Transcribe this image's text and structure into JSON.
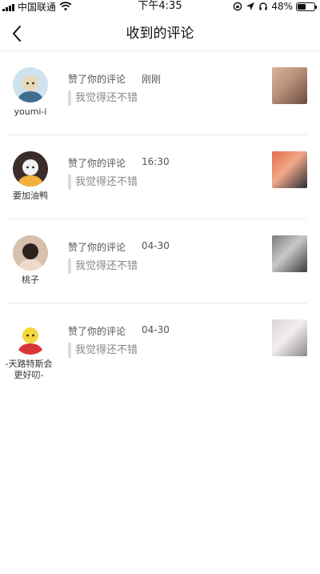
{
  "status_bar": {
    "carrier": "中国联通",
    "time": "下午4:35",
    "battery": "48%",
    "battery_level": 0.48
  },
  "nav": {
    "title": "收到的评论",
    "back_icon": "chevron-left-icon"
  },
  "notifications": [
    {
      "user": "youmi-i",
      "action": "赞了你的评论",
      "time": "刚刚",
      "comment": "我觉得还不错",
      "avatar_colors": [
        "#cfe3ee",
        "#e9d9b8",
        "#3f6e91"
      ],
      "thumb_colors": [
        "#d8b49b",
        "#6a4b3f",
        "#b98f7a"
      ]
    },
    {
      "user": "要加油鸭",
      "action": "赞了你的评论",
      "time": "16:30",
      "comment": "我觉得还不错",
      "avatar_colors": [
        "#3a2d2a",
        "#f2f2f2",
        "#f0b23a"
      ],
      "thumb_colors": [
        "#e36f4d",
        "#2d2e36",
        "#f0a88a"
      ]
    },
    {
      "user": "桃子",
      "action": "赞了你的评论",
      "time": "04-30",
      "comment": "我觉得还不错",
      "avatar_colors": [
        "#d8c0ae",
        "#2b211d",
        "#f0d9c8"
      ],
      "thumb_colors": [
        "#7c7c7c",
        "#3b3b3b",
        "#c9c9c9"
      ]
    },
    {
      "user": "-天路特斯会更好叨-",
      "action": "赞了你的评论",
      "time": "04-30",
      "comment": "我觉得还不错",
      "avatar_colors": [
        "#ffffff",
        "#f4d63c",
        "#d8353a"
      ],
      "thumb_colors": [
        "#d9d4d8",
        "#8c8a8f",
        "#f2eef0"
      ]
    }
  ]
}
